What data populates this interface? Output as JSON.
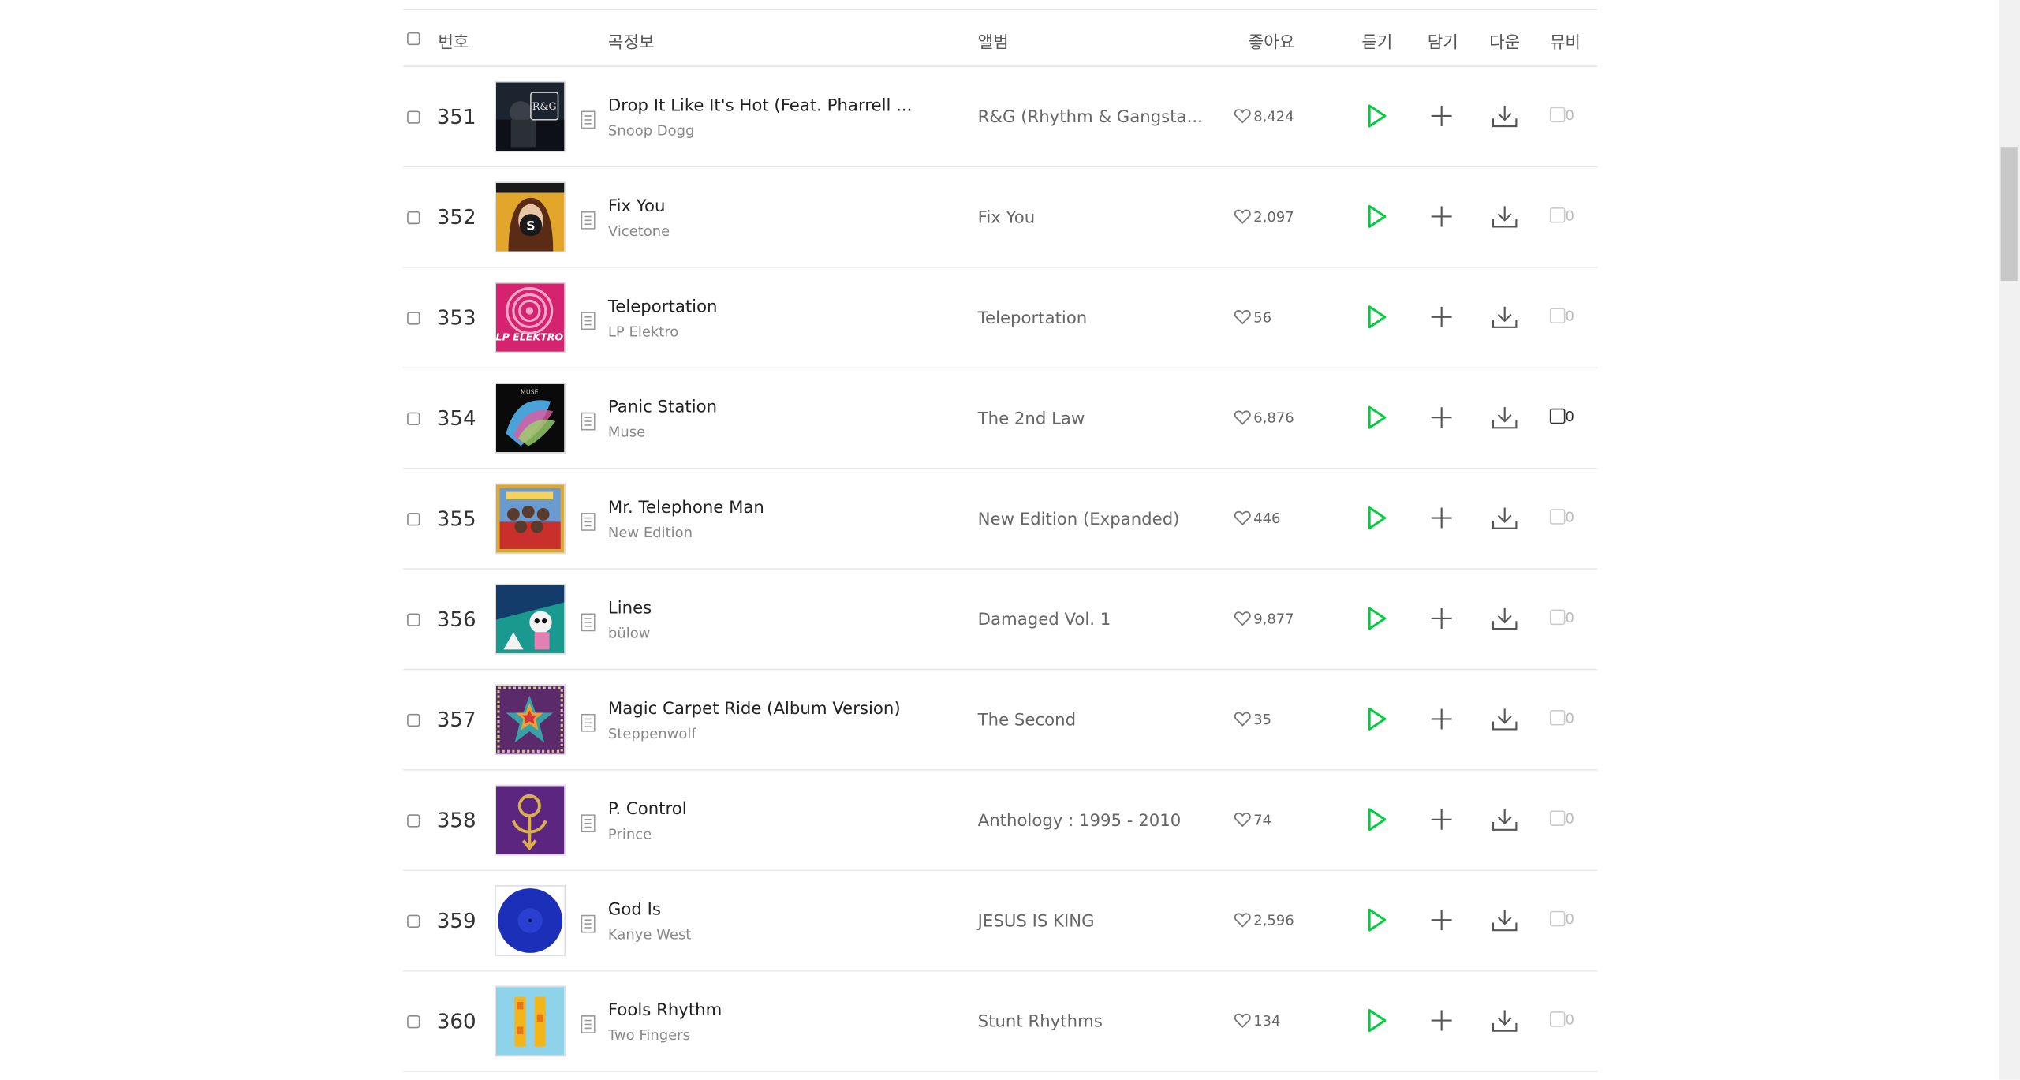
{
  "header": {
    "number": "번호",
    "song_info": "곡정보",
    "album": "앨범",
    "likes": "좋아요",
    "listen": "듣기",
    "add": "담기",
    "download": "다운",
    "mv": "뮤비"
  },
  "rows": [
    {
      "num": "351",
      "title": "Drop It Like It's Hot (Feat. Pharrell ...",
      "artist": "Snoop Dogg",
      "album": "R&G (Rhythm & Gangsta...",
      "likes": "8,424",
      "mv_count": "0"
    },
    {
      "num": "352",
      "title": "Fix You",
      "artist": "Vicetone",
      "album": "Fix You",
      "likes": "2,097",
      "mv_count": "0"
    },
    {
      "num": "353",
      "title": "Teleportation",
      "artist": "LP Elektro",
      "album": "Teleportation",
      "likes": "56",
      "mv_count": "0"
    },
    {
      "num": "354",
      "title": "Panic Station",
      "artist": "Muse",
      "album": "The 2nd Law",
      "likes": "6,876",
      "mv_count": "0"
    },
    {
      "num": "355",
      "title": "Mr. Telephone Man",
      "artist": "New Edition",
      "album": "New Edition (Expanded)",
      "likes": "446",
      "mv_count": "0"
    },
    {
      "num": "356",
      "title": "Lines",
      "artist": "bülow",
      "album": "Damaged Vol. 1",
      "likes": "9,877",
      "mv_count": "0"
    },
    {
      "num": "357",
      "title": "Magic Carpet Ride (Album Version)",
      "artist": "Steppenwolf",
      "album": "The Second",
      "likes": "35",
      "mv_count": "0"
    },
    {
      "num": "358",
      "title": "P. Control",
      "artist": "Prince",
      "album": "Anthology : 1995 - 2010",
      "likes": "74",
      "mv_count": "0"
    },
    {
      "num": "359",
      "title": "God Is",
      "artist": "Kanye West",
      "album": "JESUS IS KING",
      "likes": "2,596",
      "mv_count": "0"
    },
    {
      "num": "360",
      "title": "Fools Rhythm",
      "artist": "Two Fingers",
      "album": "Stunt Rhythms",
      "likes": "134",
      "mv_count": "0"
    }
  ],
  "cover_text": {
    "row351": "R&G",
    "row353": "LP ELEKTRO"
  },
  "colors": {
    "accent_green": "#00cd3c",
    "text_dark": "#222222",
    "text_muted": "#888888",
    "border": "#e8e8e8"
  },
  "icons": {
    "likes": "heart-icon",
    "info": "song-info-icon",
    "listen": "play-icon",
    "add": "plus-icon",
    "download": "download-icon",
    "mv": "mv-box-icon"
  }
}
